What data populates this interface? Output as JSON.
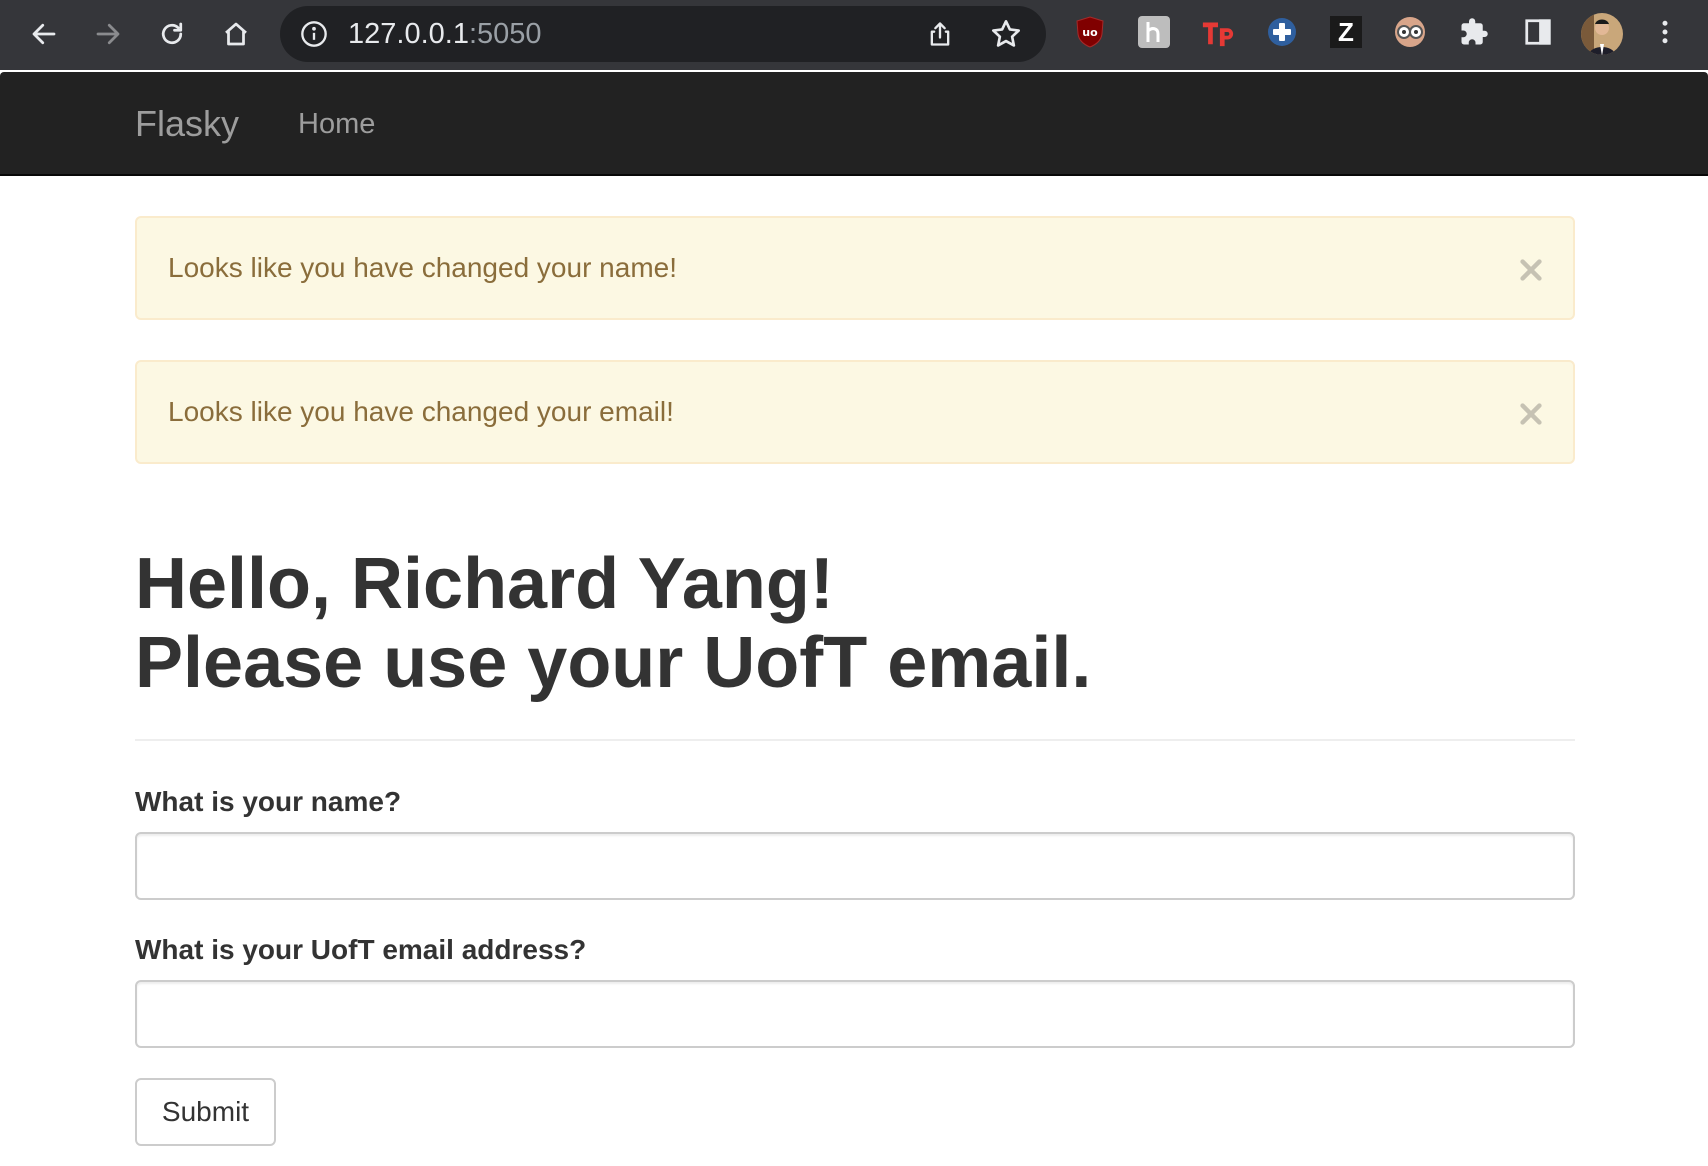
{
  "browser": {
    "url_host": "127.0.0.1",
    "url_port": ":5050"
  },
  "navbar": {
    "brand": "Flasky",
    "home_label": "Home"
  },
  "alerts": [
    {
      "message": "Looks like you have changed your name!"
    },
    {
      "message": "Looks like you have changed your email!"
    }
  ],
  "heading": {
    "line1": "Hello, Richard Yang!",
    "line2": "Please use your UofT email."
  },
  "form": {
    "name_label": "What is your name?",
    "name_value": "",
    "email_label": "What is your UofT email address?",
    "email_value": "",
    "submit_label": "Submit"
  },
  "extensions": {
    "z_label": "Z"
  },
  "colors": {
    "navbar_bg": "#222222",
    "alert_bg": "#fcf8e3",
    "alert_text": "#8a6d3b",
    "chrome_bg": "#35363a"
  }
}
